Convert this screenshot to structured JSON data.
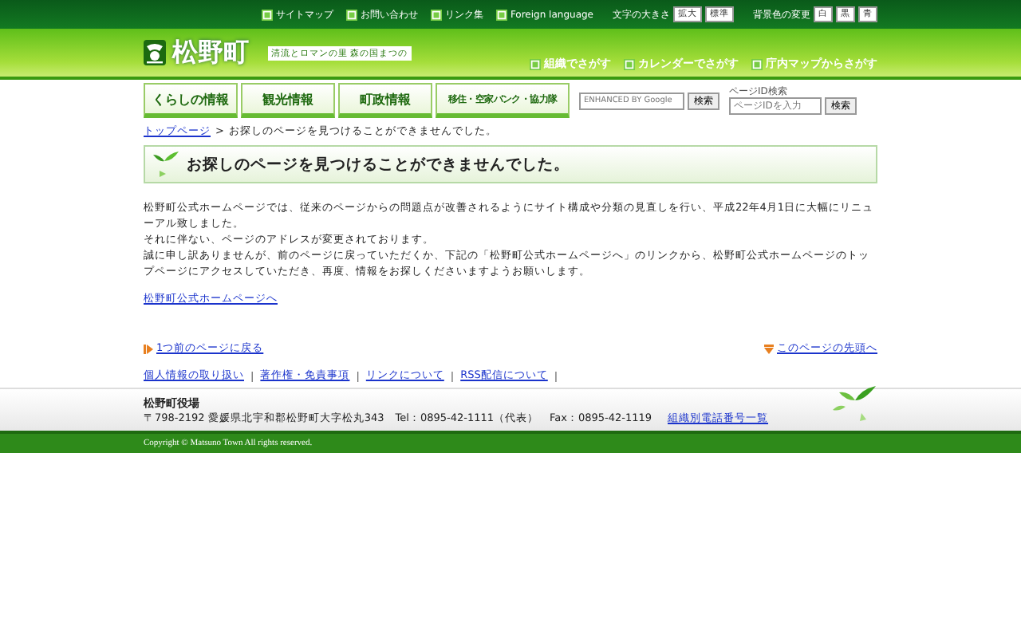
{
  "utility_links": [
    "サイトマップ",
    "お問い合わせ",
    "リンク集",
    "Foreign language"
  ],
  "font_size": {
    "label": "文字の大きさ",
    "buttons": [
      "拡大",
      "標準"
    ]
  },
  "background_color": {
    "label": "背景色の変更",
    "buttons": [
      "白",
      "黒",
      "青"
    ]
  },
  "site_title": "松野町",
  "tagline": "清流とロマンの里 森の国まつの",
  "search_links": [
    "組織でさがす",
    "カレンダーでさがす",
    "庁内マップからさがす"
  ],
  "nav_tabs": [
    {
      "label": "くらしの情報",
      "selected": false
    },
    {
      "label": "観光情報",
      "selected": false
    },
    {
      "label": "町政情報",
      "selected": false
    },
    {
      "label": "移住・空家バンク・協力隊",
      "selected": false
    }
  ],
  "site_search": {
    "placeholder": "ENHANCED BY Google",
    "button": "検索"
  },
  "page_id_search": {
    "label": "ページID検索",
    "placeholder": "ページIDを入力",
    "button": "検索"
  },
  "breadcrumb": {
    "home": "トップページ",
    "separator": ">",
    "current": "お探しのページを見つけることができませんでした。"
  },
  "heading": "お探しのページを見つけることができませんでした。",
  "paragraphs": [
    "松野町公式ホームページでは、従来のページからの問題点が改善されるようにサイト構成や分類の見直しを行い、平成22年4月1日に大幅にリニューアル致しました。",
    "それに伴ない、ページのアドレスが変更されております。",
    "誠に申し訳ありませんが、前のページに戻っていただくか、下記の「松野町公式ホームページへ」のリンクから、松野町公式ホームページのトップページにアクセスしていただき、再度、情報をお探しくださいますようお願いします。"
  ],
  "home_link": "松野町公式ホームページへ",
  "back_link": "1つ前のページに戻る",
  "top_link": "このページの先頭へ",
  "footer_links": [
    "個人情報の取り扱い",
    "著作権・免責事項",
    "リンクについて",
    "RSS配信について"
  ],
  "footer_link_separator": "|",
  "office": {
    "name": "松野町役場",
    "address": "〒798-2192 愛媛県北宇和郡松野町大字松丸343　Tel：0895-42-1111（代表）　Fax：0895-42-1119",
    "phone_link": "組織別電話番号一覧"
  },
  "copyright": "Copyright © Matsuno Town All rights reserved."
}
